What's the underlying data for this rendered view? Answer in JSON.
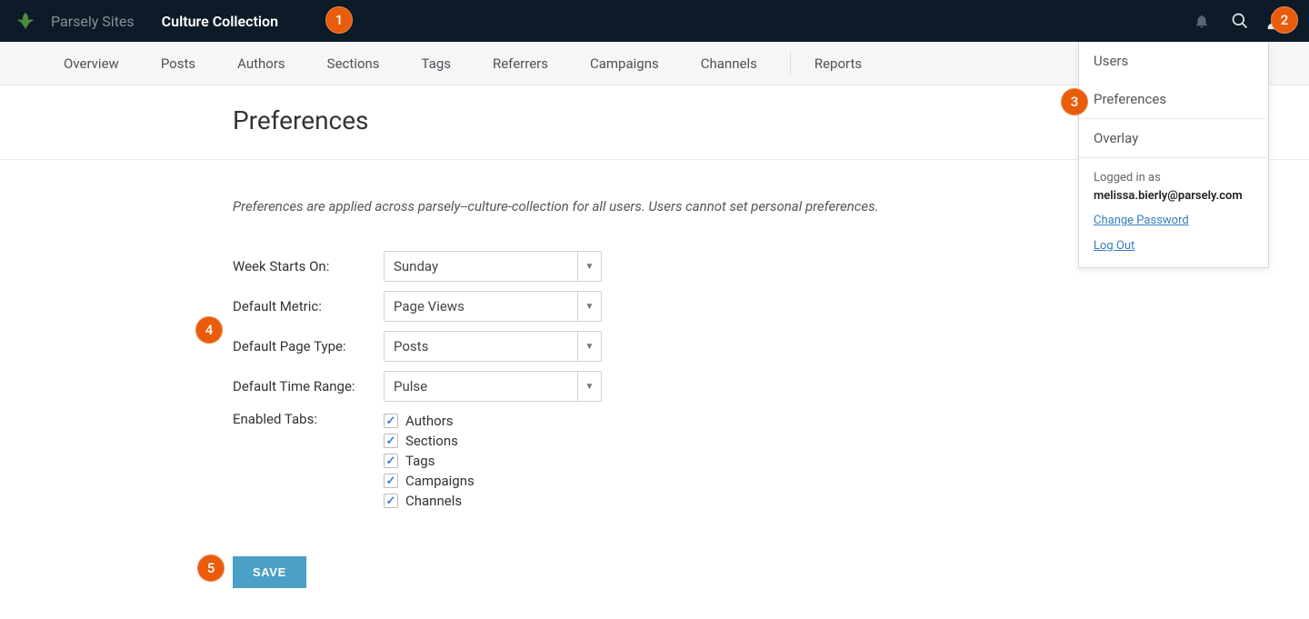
{
  "topbar": {
    "brand": "Parsely Sites",
    "site_name": "Culture Collection"
  },
  "annotations": {
    "a1": "1",
    "a2": "2",
    "a3": "3",
    "a4": "4",
    "a5": "5"
  },
  "subnav": {
    "items": [
      "Overview",
      "Posts",
      "Authors",
      "Sections",
      "Tags",
      "Referrers",
      "Campaigns",
      "Channels"
    ],
    "reports": "Reports"
  },
  "page": {
    "title": "Preferences",
    "hint": "Preferences are applied across parsely--culture-collection for all users. Users cannot set personal preferences."
  },
  "form": {
    "week_label": "Week Starts On:",
    "week_value": "Sunday",
    "metric_label": "Default Metric:",
    "metric_value": "Page Views",
    "pagetype_label": "Default Page Type:",
    "pagetype_value": "Posts",
    "timerange_label": "Default Time Range:",
    "timerange_value": "Pulse",
    "enabled_label": "Enabled Tabs:",
    "enabled": [
      "Authors",
      "Sections",
      "Tags",
      "Campaigns",
      "Channels"
    ],
    "save": "SAVE"
  },
  "dropdown": {
    "items": [
      "Users",
      "Preferences",
      "Overlay"
    ],
    "logged_label": "Logged in as",
    "email": "melissa.bierly@parsely.com",
    "change_password": "Change Password",
    "log_out": "Log Out"
  }
}
